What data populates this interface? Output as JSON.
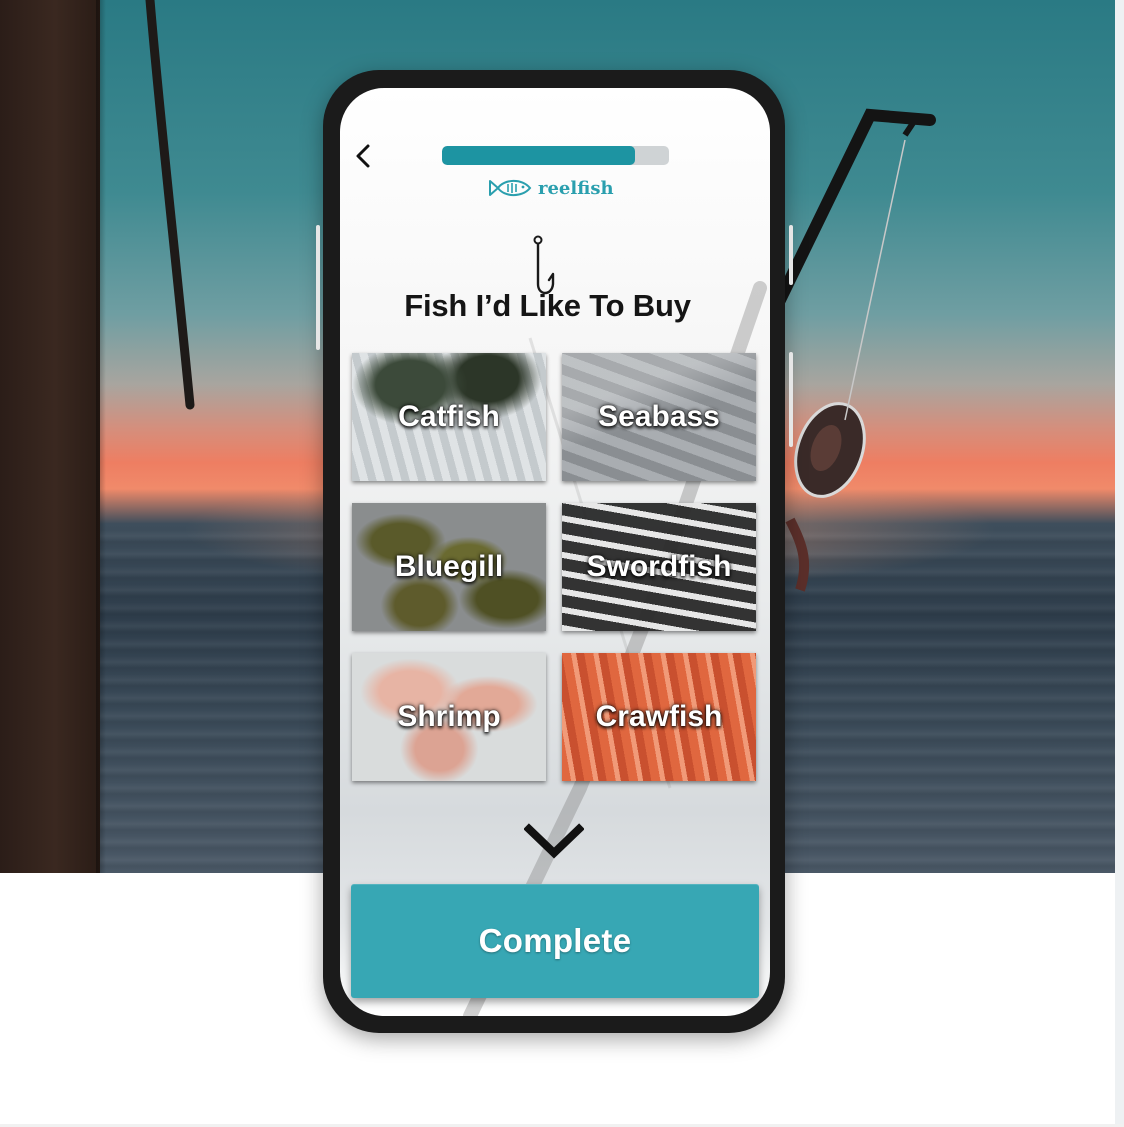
{
  "app": {
    "brand_name": "reelfish",
    "accent_color": "#37a7b4",
    "progress_fraction": 0.85
  },
  "header": {
    "back_icon": "chevron-left-icon",
    "logo_icon": "fish-logo-icon"
  },
  "page": {
    "title": "Fish I’d Like To Buy",
    "decor_icon": "fishing-hook-icon"
  },
  "fish_options": [
    {
      "label": "Catfish"
    },
    {
      "label": "Seabass"
    },
    {
      "label": "Bluegill"
    },
    {
      "label": "Swordfish"
    },
    {
      "label": "Shrimp"
    },
    {
      "label": "Crawfish"
    }
  ],
  "scroll_more_icon": "chevron-down-icon",
  "actions": {
    "complete_label": "Complete"
  }
}
